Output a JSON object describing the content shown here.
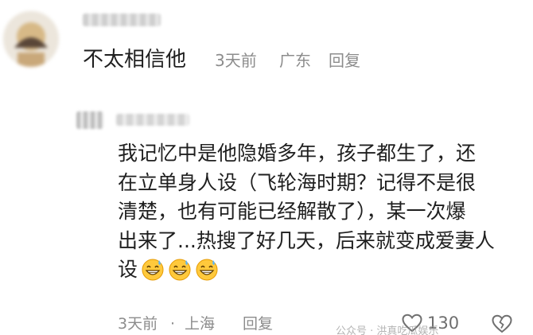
{
  "top_comment": {
    "avatar_icon": "blurred-user-avatar",
    "text": "不太相信他",
    "time": "3天前",
    "location": "广东",
    "reply_label": "回复"
  },
  "reply_comment": {
    "avatar_icon": "blurred-user-avatar",
    "lines": [
      "我记忆中是他隐婚多年，孩子都生了，还",
      "在立单身人设（飞轮海时期？记得不是很",
      "清楚，也有可能已经解散了），某一次爆",
      "出来了...热搜了好几天，后来就变成爱妻人",
      "设"
    ],
    "emoji_icons": [
      "grinning-sweat-emoji",
      "grinning-sweat-emoji",
      "grinning-sweat-emoji"
    ],
    "time": "3天前",
    "separator": "·",
    "location": "上海",
    "reply_label": "回复",
    "like_icon": "heart-outline-icon",
    "like_count": "130",
    "dislike_icon": "broken-heart-outline-icon"
  },
  "watermark": "公众号 · 洪真吃瓜娱乐"
}
